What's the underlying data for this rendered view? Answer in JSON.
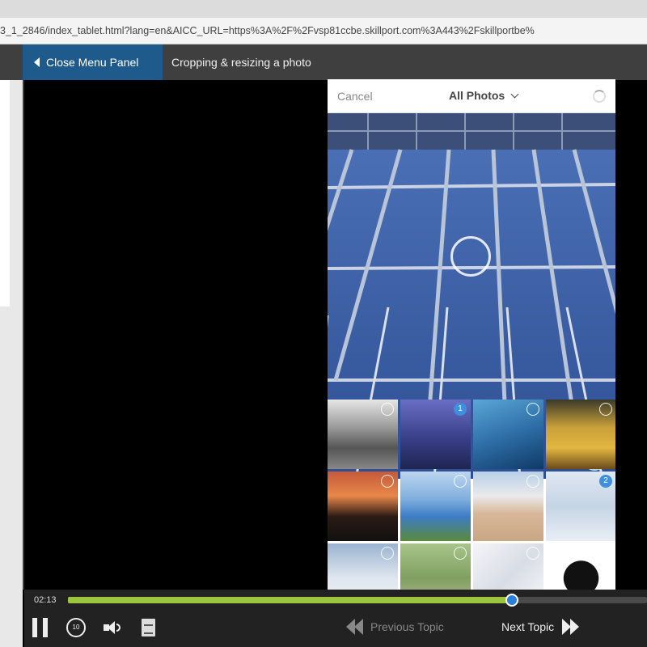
{
  "browser": {
    "url": "3_1_2846/index_tablet.html?lang=en&AICC_URL=https%3A%2F%2Fvsp81ccbe.skillport.com%3A443%2Fskillportbe%"
  },
  "header": {
    "close_menu_label": "Close Menu Panel",
    "lesson_title": "Cropping & resizing a photo"
  },
  "phone": {
    "cancel_label": "Cancel",
    "album_label": "All Photos",
    "thumbnails": [
      {
        "name": "photo-city-bw",
        "selected_number": null
      },
      {
        "name": "photo-golden-gate",
        "selected_number": "1"
      },
      {
        "name": "photo-whale",
        "selected_number": null
      },
      {
        "name": "photo-colosseum",
        "selected_number": null
      },
      {
        "name": "photo-brandenburg-gate",
        "selected_number": null
      },
      {
        "name": "photo-solar-field",
        "selected_number": null
      },
      {
        "name": "photo-stadium",
        "selected_number": null
      },
      {
        "name": "photo-solar-panels",
        "selected_number": "2"
      },
      {
        "name": "photo-snow",
        "selected_number": null
      },
      {
        "name": "photo-hillside",
        "selected_number": null
      },
      {
        "name": "photo-white-fabric",
        "selected_number": null
      },
      {
        "name": "photo-geodesic",
        "selected_number": null
      }
    ]
  },
  "player": {
    "elapsed": "02:13",
    "progress": 0.767,
    "replay_seconds": "10",
    "previous_label": "Previous Topic",
    "next_label": "Next Topic"
  },
  "colors": {
    "accent_blue": "#1f5a8c",
    "progress_green": "#9cc43c",
    "ios_blue": "#3e8fe0"
  }
}
